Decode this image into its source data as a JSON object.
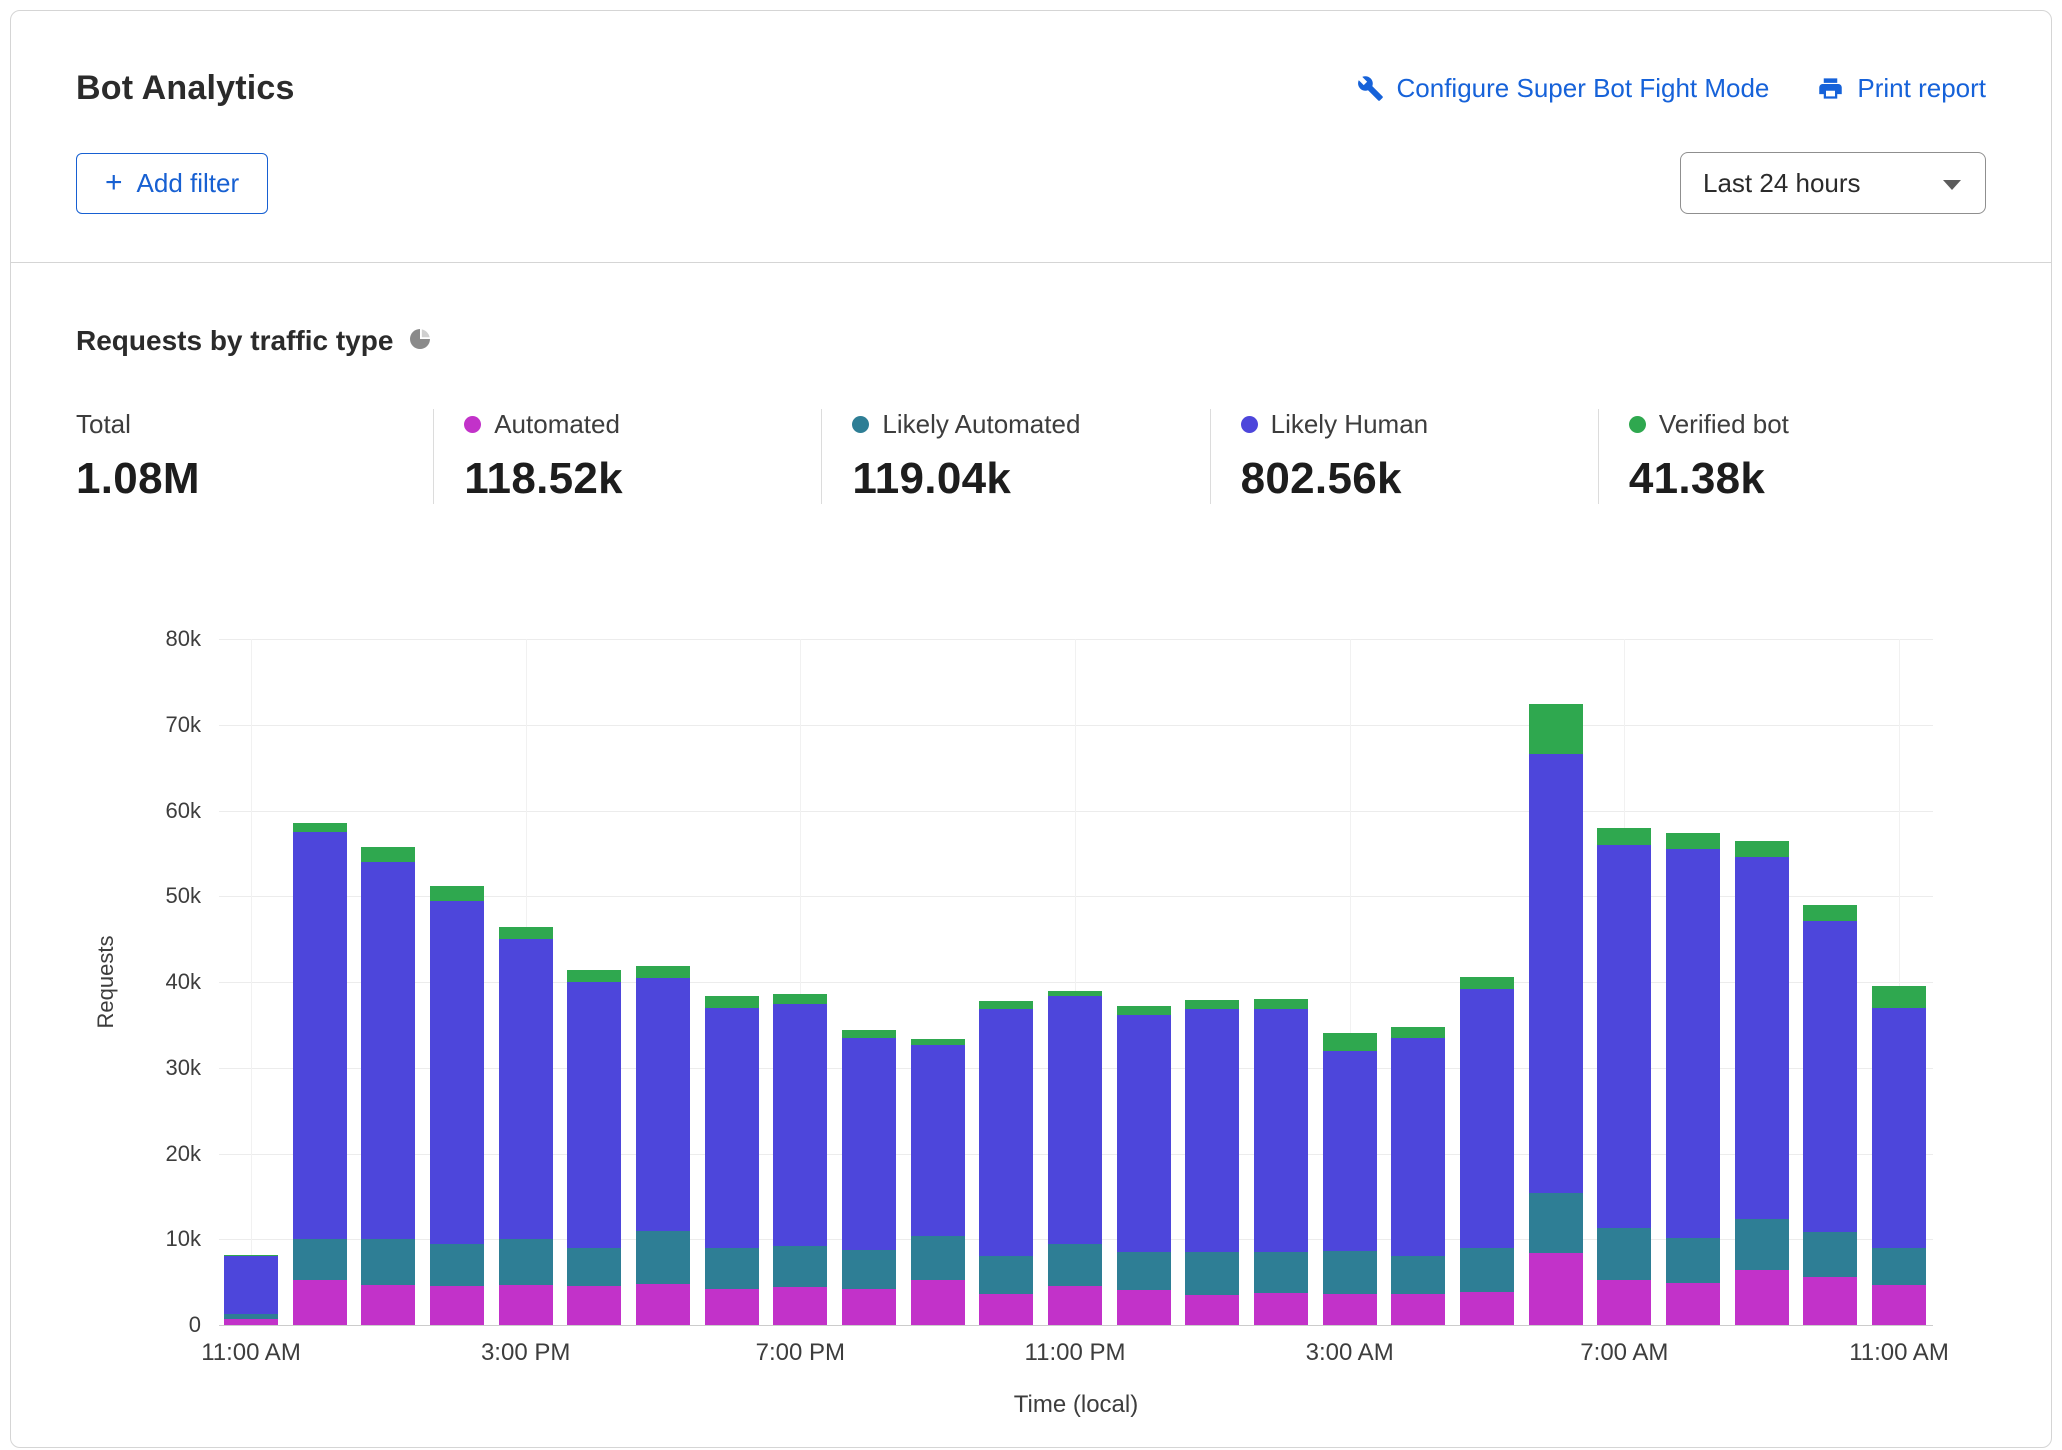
{
  "header": {
    "title": "Bot Analytics",
    "configure_link": "Configure Super Bot Fight Mode",
    "print_link": "Print report",
    "add_filter_label": "Add filter",
    "time_range_value": "Last 24 hours"
  },
  "section": {
    "title": "Requests by traffic type"
  },
  "stats": [
    {
      "label": "Total",
      "value": "1.08M",
      "color": null
    },
    {
      "label": "Automated",
      "value": "118.52k",
      "color": "#C232C9"
    },
    {
      "label": "Likely Automated",
      "value": "119.04k",
      "color": "#2E7E95"
    },
    {
      "label": "Likely Human",
      "value": "802.56k",
      "color": "#4D46DB"
    },
    {
      "label": "Verified bot",
      "value": "41.38k",
      "color": "#2FA84F"
    }
  ],
  "colors": {
    "link_blue": "#1662D9",
    "automated": "#C232C9",
    "likely_automated": "#2E7E95",
    "likely_human": "#4D46DB",
    "verified_bot": "#2FA84F"
  },
  "chart_data": {
    "type": "bar",
    "stacked": true,
    "title": "Requests by traffic type",
    "xlabel": "Time (local)",
    "ylabel": "Requests",
    "ylim": [
      0,
      80000
    ],
    "grid": true,
    "legend_position": "top-stats-row",
    "y_tick_labels": [
      "0",
      "10k",
      "20k",
      "30k",
      "40k",
      "50k",
      "60k",
      "70k",
      "80k"
    ],
    "x_tick_labels": [
      "11:00 AM",
      "3:00 PM",
      "7:00 PM",
      "11:00 PM",
      "3:00 AM",
      "7:00 AM",
      "11:00 AM"
    ],
    "x_tick_bar_indices": [
      0,
      4,
      8,
      12,
      16,
      20,
      24
    ],
    "bar_count": 25,
    "series": [
      {
        "name": "Automated",
        "color": "#C232C9",
        "values": [
          700,
          5200,
          4700,
          4600,
          4700,
          4500,
          4800,
          4200,
          4400,
          4200,
          5200,
          3600,
          4500,
          4100,
          3500,
          3700,
          3600,
          3600,
          3800,
          8400,
          5200,
          4900,
          6400,
          5600,
          4700
        ]
      },
      {
        "name": "Likely Automated",
        "color": "#2E7E95",
        "values": [
          600,
          4800,
          5300,
          4900,
          5300,
          4500,
          6200,
          4800,
          4800,
          4600,
          5200,
          4400,
          5000,
          4400,
          5000,
          4800,
          5000,
          4400,
          5200,
          7000,
          6100,
          5300,
          6000,
          5300,
          4300
        ]
      },
      {
        "name": "Likely Human",
        "color": "#4D46DB",
        "values": [
          6700,
          47500,
          44000,
          40000,
          35000,
          31000,
          29500,
          28000,
          28200,
          24700,
          22200,
          28900,
          28900,
          27700,
          28400,
          28300,
          23400,
          25500,
          30200,
          51200,
          44700,
          45300,
          42200,
          36200,
          28000
        ]
      },
      {
        "name": "Verified bot",
        "color": "#2FA84F",
        "values": [
          200,
          1100,
          1700,
          1700,
          1400,
          1400,
          1400,
          1400,
          1200,
          900,
          800,
          900,
          600,
          1000,
          1000,
          1200,
          2100,
          1200,
          1400,
          5800,
          2000,
          1900,
          1900,
          1900,
          2500
        ]
      }
    ]
  }
}
